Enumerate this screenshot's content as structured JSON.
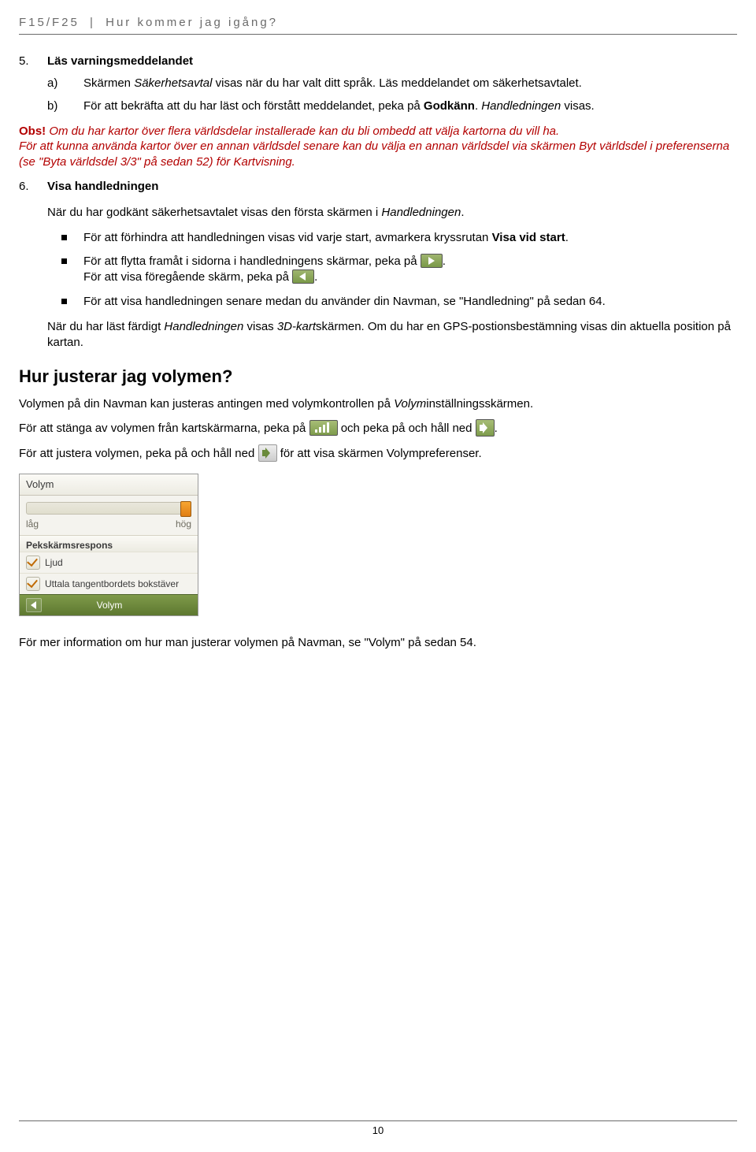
{
  "header": {
    "product": "F15/F25",
    "section": "Hur kommer jag igång?"
  },
  "step5": {
    "num": "5.",
    "title": "Läs varningsmeddelandet",
    "items": [
      {
        "lbl": "a)",
        "pre": "Skärmen ",
        "ital": "Säkerhetsavtal",
        "post": " visas när du har valt ditt språk. Läs meddelandet om säkerhetsavtalet."
      },
      {
        "lbl": "b)",
        "pre": "För att bekräfta att du har läst och förstått meddelandet, peka på ",
        "bold": "Godkänn",
        "post2": ". ",
        "ital2": "Handledningen",
        "post3": " visas."
      }
    ]
  },
  "obs": {
    "label": "Obs!",
    "line1": " Om du har kartor över flera världsdelar installerade kan du bli ombedd att välja kartorna du vill ha.",
    "line2a": "För att kunna använda kartor över en annan världsdel senare kan du välja en annan världsdel via skärmen ",
    "line2_ital": "Byt världsdel",
    "line2b": " i preferenserna (se \"Byta världsdel 3/3\" på sedan 52) för ",
    "line2_ital2": "Kartvisning",
    "line2c": "."
  },
  "step6": {
    "num": "6.",
    "title": "Visa handledningen",
    "intro_pre": "När du har godkänt säkerhetsavtalet visas den första skärmen i ",
    "intro_ital": "Handledningen",
    "intro_post": ".",
    "bullets": {
      "b1_pre": "För att förhindra att handledningen visas vid varje start, avmarkera kryssrutan ",
      "b1_bold": "Visa vid start",
      "b1_post": ".",
      "b2_pre": "För att flytta framåt i sidorna i handledningens skärmar, peka på ",
      "b2_post": ".",
      "b2b_pre": "För att visa föregående skärm, peka på ",
      "b2b_post": ".",
      "b3": "För att visa handledningen senare medan du använder din Navman, se \"Handledning\" på sedan 64."
    },
    "post_pre": "När du har läst färdigt ",
    "post_it1": "Handledningen",
    "post_mid": " visas ",
    "post_it2": "3D-kart",
    "post_after": "skärmen. Om du har en GPS-postionsbestämning visas din aktuella position på kartan."
  },
  "volumeSection": {
    "heading": "Hur justerar jag volymen?",
    "p1_pre": "Volymen på din Navman kan justeras antingen med volymkontrollen på ",
    "p1_ital": "Volym",
    "p1_post": "inställningsskärmen.",
    "p2_pre": "För att stänga av volymen från kartskärmarna, peka på ",
    "p2_mid": " och peka på och håll ned ",
    "p2_post": ".",
    "p3_pre": "För att justera volymen, peka på och håll ned ",
    "p3_post": " för att visa skärmen Volympreferenser."
  },
  "widget": {
    "title": "Volym",
    "low": "låg",
    "high": "hög",
    "section": "Pekskärmsrespons",
    "opt1": "Ljud",
    "opt2": "Uttala tangentbordets bokstäver",
    "footer": "Volym"
  },
  "closing": "För mer information om hur man justerar volymen på Navman, se \"Volym\" på sedan 54.",
  "pageNumber": "10"
}
